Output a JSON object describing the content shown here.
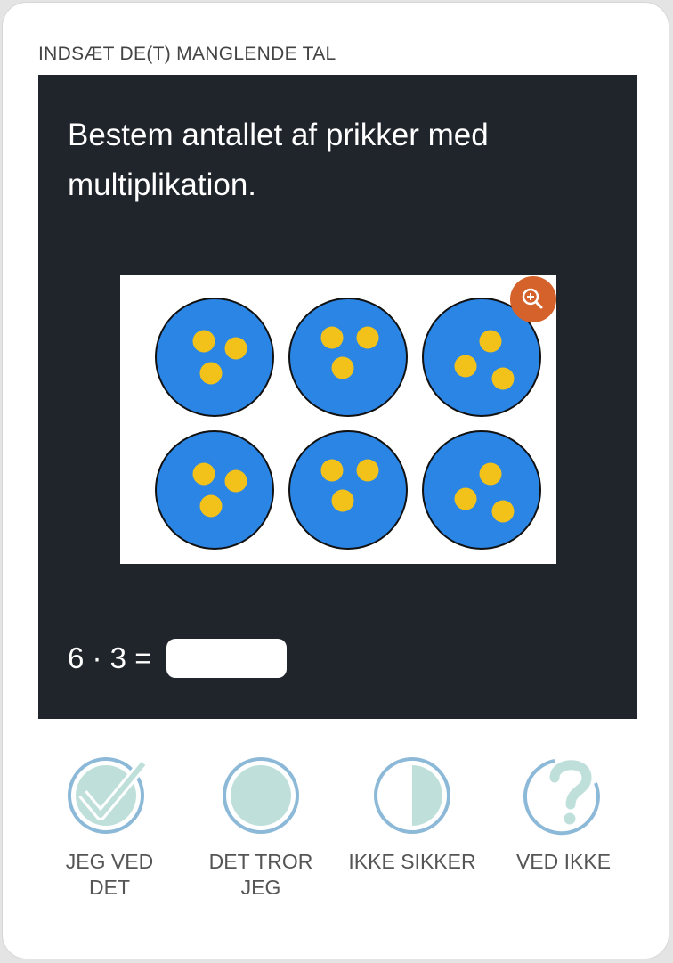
{
  "task_type": "INDSÆT DE(T) MANGLENDE TAL",
  "question": "Bestem antallet af prikker med multiplikation.",
  "figure": {
    "groups": 6,
    "dots_per_group": 3,
    "circle_color": "#2b85e4",
    "dot_color": "#f2c21b"
  },
  "zoom_icon": "zoom-in-icon",
  "equation": {
    "text": "6 · 3 =",
    "answer_value": ""
  },
  "confidence": [
    {
      "label": "JEG VED\nDET",
      "icon": "check-circle-icon"
    },
    {
      "label": "DET TROR\nJEG",
      "icon": "filled-circle-icon"
    },
    {
      "label": "IKKE SIKKER",
      "icon": "half-circle-icon"
    },
    {
      "label": "VED IKKE",
      "icon": "question-circle-icon"
    }
  ],
  "colors": {
    "panel": "#20242b",
    "confidence_fill": "#bfe0da",
    "confidence_ring": "#8db9d8",
    "zoom_button": "#d4622a"
  }
}
